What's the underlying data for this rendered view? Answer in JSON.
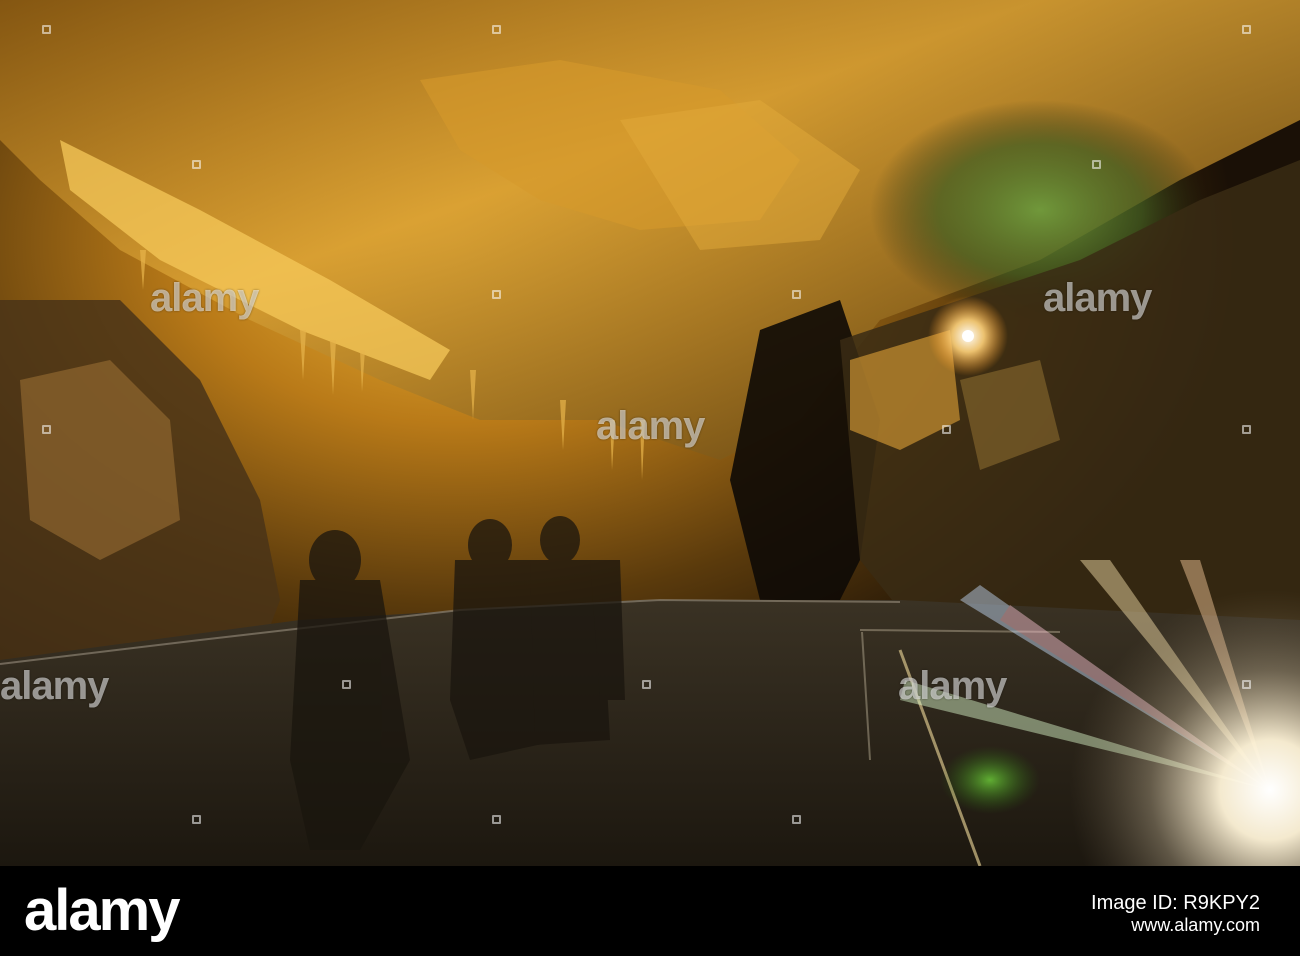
{
  "photo": {
    "subject": "cave-interior",
    "colors": {
      "rock_warm": "#c98a1e",
      "rock_highlight": "#f2c24a",
      "rock_green": "#4f7a2c",
      "shadow": "#120c05",
      "floor": "#2a2418",
      "flare": "#fff6e0"
    },
    "watermark_text": "alamy"
  },
  "banner": {
    "logo_text": "alamy",
    "site": "www.alamy.com",
    "image_id_label": "Image ID:",
    "image_id": "R9KPY2"
  }
}
